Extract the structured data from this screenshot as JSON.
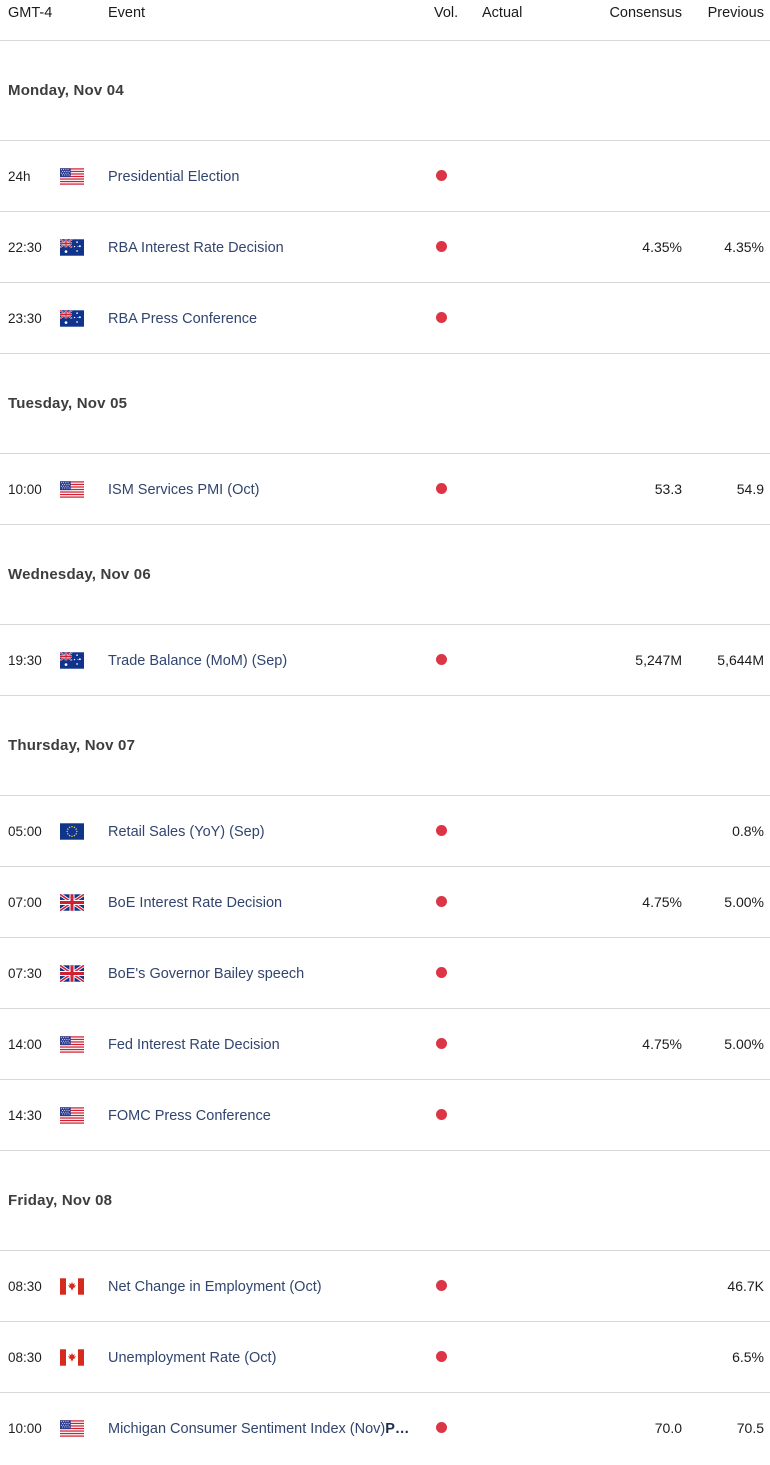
{
  "header": {
    "time_label": "GMT-4",
    "event_label": "Event",
    "vol_label": "Vol.",
    "actual_label": "Actual",
    "consensus_label": "Consensus",
    "previous_label": "Previous"
  },
  "colors": {
    "volatility_dot": "#dc3545",
    "event_link": "#31456f",
    "day_header": "#3d3d3d",
    "row_separator": "#d8d8d8"
  },
  "groups": [
    {
      "day": "Monday, Nov 04",
      "events": [
        {
          "time": "24h",
          "flag": "us",
          "name": "Presidential Election",
          "prelim": "",
          "volatility": "high",
          "actual": "",
          "consensus": "",
          "previous": ""
        },
        {
          "time": "22:30",
          "flag": "au",
          "name": "RBA Interest Rate Decision",
          "prelim": "",
          "volatility": "high",
          "actual": "",
          "consensus": "4.35%",
          "previous": "4.35%"
        },
        {
          "time": "23:30",
          "flag": "au",
          "name": "RBA Press Conference",
          "prelim": "",
          "volatility": "high",
          "actual": "",
          "consensus": "",
          "previous": ""
        }
      ]
    },
    {
      "day": "Tuesday, Nov 05",
      "events": [
        {
          "time": "10:00",
          "flag": "us",
          "name": "ISM Services PMI (Oct)",
          "prelim": "",
          "volatility": "high",
          "actual": "",
          "consensus": "53.3",
          "previous": "54.9"
        }
      ]
    },
    {
      "day": "Wednesday, Nov 06",
      "events": [
        {
          "time": "19:30",
          "flag": "au",
          "name": "Trade Balance (MoM) (Sep)",
          "prelim": "",
          "volatility": "high",
          "actual": "",
          "consensus": "5,247M",
          "previous": "5,644M"
        }
      ]
    },
    {
      "day": "Thursday, Nov 07",
      "events": [
        {
          "time": "05:00",
          "flag": "eu",
          "name": "Retail Sales (YoY) (Sep)",
          "prelim": "",
          "volatility": "high",
          "actual": "",
          "consensus": "",
          "previous": "0.8%"
        },
        {
          "time": "07:00",
          "flag": "gb",
          "name": "BoE Interest Rate Decision",
          "prelim": "",
          "volatility": "high",
          "actual": "",
          "consensus": "4.75%",
          "previous": "5.00%"
        },
        {
          "time": "07:30",
          "flag": "gb",
          "name": "BoE's Governor Bailey speech",
          "prelim": "",
          "volatility": "high",
          "actual": "",
          "consensus": "",
          "previous": ""
        },
        {
          "time": "14:00",
          "flag": "us",
          "name": "Fed Interest Rate Decision",
          "prelim": "",
          "volatility": "high",
          "actual": "",
          "consensus": "4.75%",
          "previous": "5.00%"
        },
        {
          "time": "14:30",
          "flag": "us",
          "name": "FOMC Press Conference",
          "prelim": "",
          "volatility": "high",
          "actual": "",
          "consensus": "",
          "previous": ""
        }
      ]
    },
    {
      "day": "Friday, Nov 08",
      "events": [
        {
          "time": "08:30",
          "flag": "ca",
          "name": "Net Change in Employment (Oct)",
          "prelim": "",
          "volatility": "high",
          "actual": "",
          "consensus": "",
          "previous": "46.7K"
        },
        {
          "time": "08:30",
          "flag": "ca",
          "name": "Unemployment Rate (Oct)",
          "prelim": "",
          "volatility": "high",
          "actual": "",
          "consensus": "",
          "previous": "6.5%"
        },
        {
          "time": "10:00",
          "flag": "us",
          "name": "Michigan Consumer Sentiment Index (Nov)",
          "prelim": "P…",
          "volatility": "high",
          "actual": "",
          "consensus": "70.0",
          "previous": "70.5"
        }
      ]
    }
  ]
}
